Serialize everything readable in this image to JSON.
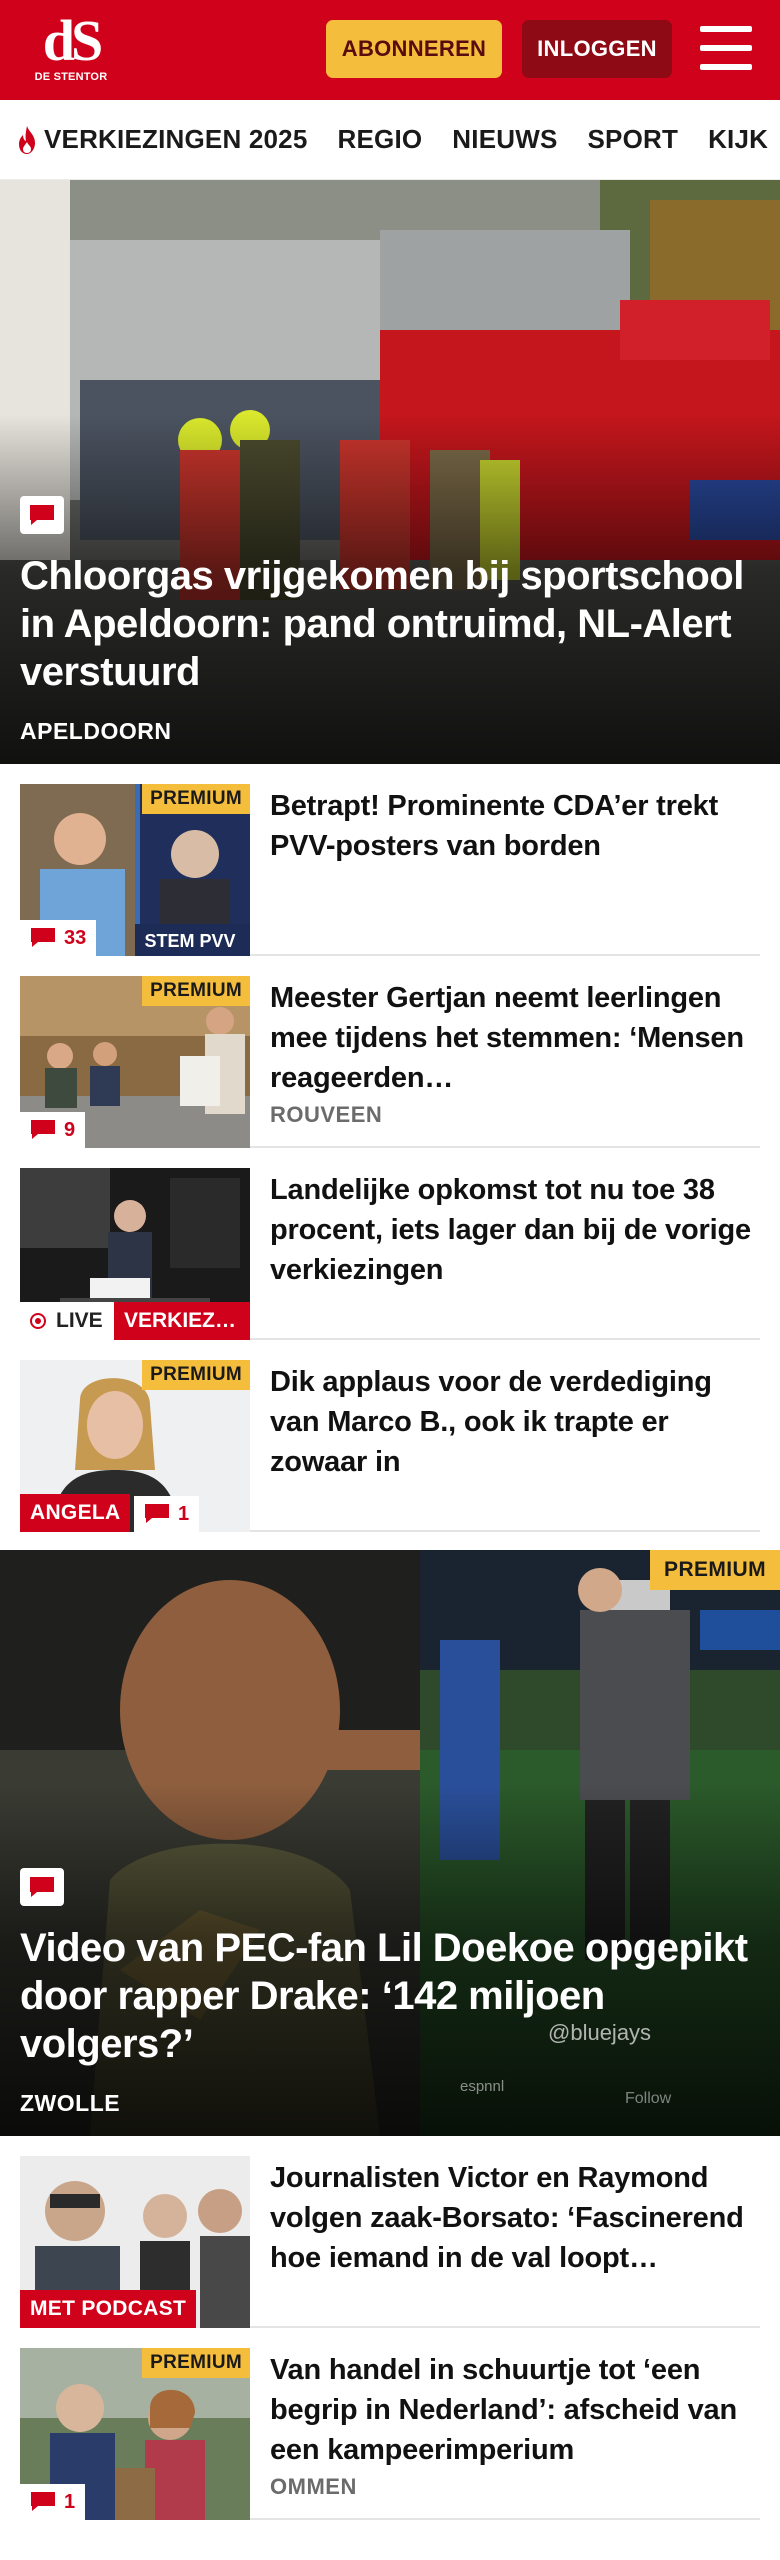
{
  "header": {
    "logo_text": "dS",
    "logo_sub": "DE STENTOR",
    "subscribe_label": "ABONNEREN",
    "login_label": "INLOGGEN",
    "menu_icon": "hamburger-menu-icon"
  },
  "nav": {
    "items": [
      {
        "label": "VERKIEZINGEN 2025",
        "icon": "flame-icon"
      },
      {
        "label": "REGIO"
      },
      {
        "label": "NIEUWS"
      },
      {
        "label": "SPORT"
      },
      {
        "label": "KIJK"
      }
    ]
  },
  "colors": {
    "brand_red": "#d0021b",
    "premium_yellow": "#f5bd3c",
    "login_dark_red": "#8e0a14"
  },
  "hero1": {
    "title": "Chloorgas vrijgekomen bij sport­school in Apeldoorn: pand ontruimd, NL-Alert verstuurd",
    "location": "APELDOORN",
    "badge_icon": "comment-icon"
  },
  "articles": [
    {
      "title": "Betrapt! Prominente CDA’er trekt PVV-posters van borden",
      "premium": "PREMIUM",
      "comments": "33"
    },
    {
      "title": "Meester Gertjan neemt leerlingen mee tijdens het stemmen: ‘Mensen reageerden…",
      "premium": "PREMIUM",
      "comments": "9",
      "location": "ROUVEEN"
    },
    {
      "title": "Landelijke opkomst tot nu toe 38 procent, iets lager dan bij de vorige verkiezingen",
      "live": "LIVE",
      "tag": "VERKIEZ…"
    },
    {
      "title": "Dik applaus voor de verdediging van Marco B., ook ik trapte er zowaar in",
      "premium": "PREMIUM",
      "label": "ANGELA",
      "comments": "1"
    }
  ],
  "hero2": {
    "title": "Video van PEC-fan Lil Doekoe opgepikt door rapper Drake: ‘142 miljoen volgers?’",
    "location": "ZWOLLE",
    "premium": "PREMIUM",
    "badge_icon": "comment-icon",
    "overlay_handle": "@bluejays",
    "overlay_account": "espnnl",
    "overlay_follow": "Follow"
  },
  "articles2": [
    {
      "title": "Journalisten Victor en Raymond volgen zaak-Borsato: ‘Fascine­rend hoe iemand in de val loopt…",
      "label": "MET PODCAST"
    },
    {
      "title": "Van handel in schuurtje tot ‘een begrip in Nederland’: afscheid van een kampeerimperium",
      "premium": "PREMIUM",
      "comments": "1",
      "location": "OMMEN"
    }
  ]
}
